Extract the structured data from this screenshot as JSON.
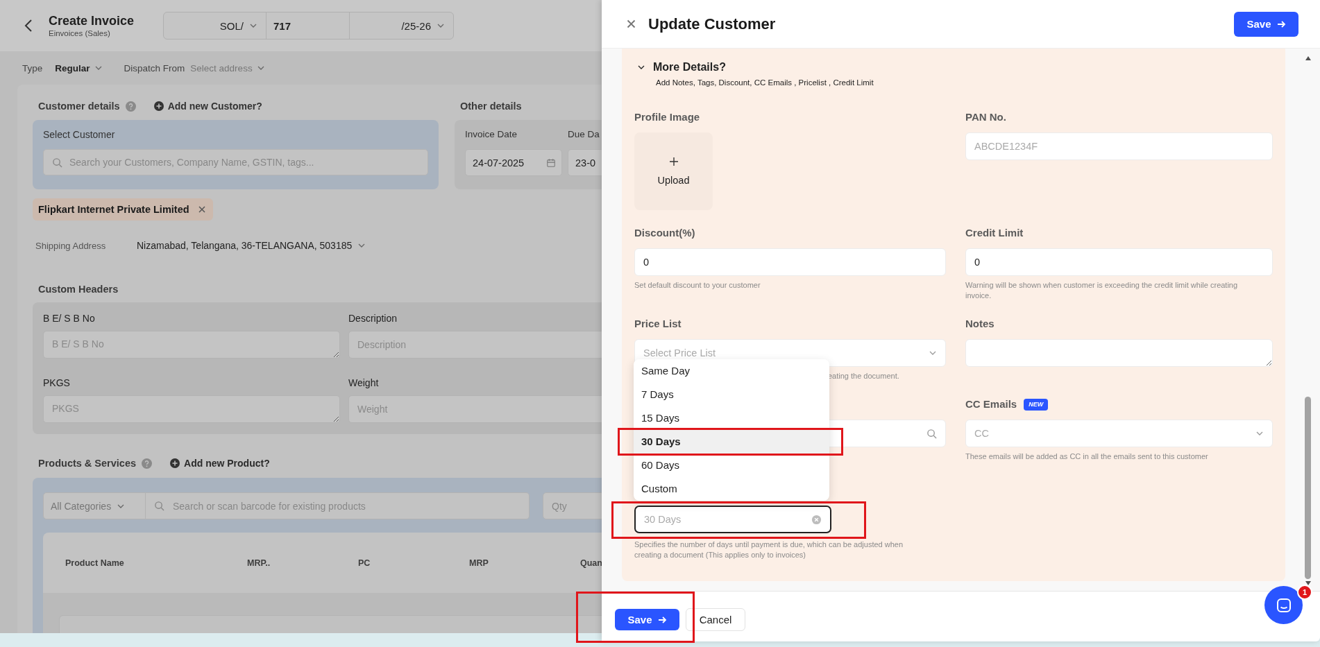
{
  "invoice_page": {
    "title": "Create Invoice",
    "subtitle": "Einvoices (Sales)",
    "number": {
      "prefix": "SOL/",
      "number": "717",
      "suffix": "/25-26"
    },
    "type": {
      "label": "Type",
      "value": "Regular"
    },
    "dispatch": {
      "label": "Dispatch From",
      "placeholder": "Select address"
    },
    "customer": {
      "heading": "Customer details",
      "add_link": "Add new Customer?",
      "select_label": "Select Customer",
      "search_placeholder": "Search your Customers, Company Name, GSTIN, tags...",
      "chip": "Flipkart Internet Private Limited",
      "shipping_label": "Shipping Address",
      "shipping_value": "Nizamabad, Telangana, 36-TELANGANA, 503185"
    },
    "other": {
      "heading": "Other details",
      "fields": [
        {
          "label": "Invoice Date",
          "value": "24-07-2025",
          "kind": "date"
        },
        {
          "label": "Due Da",
          "value": "23-0",
          "kind": "text"
        }
      ]
    },
    "custom_headers": {
      "heading": "Custom Headers",
      "fields": [
        {
          "label": "B E/ S B No",
          "placeholder": "B E/ S B No",
          "kind": "textarea"
        },
        {
          "label": "Description",
          "placeholder": "Description",
          "kind": "input"
        },
        {
          "label": "PKGS",
          "placeholder": "PKGS",
          "kind": "textarea"
        },
        {
          "label": "Weight",
          "placeholder": "Weight",
          "kind": "input"
        }
      ]
    },
    "products": {
      "heading": "Products & Services",
      "add_link": "Add new Product?",
      "category": "All Categories",
      "search_placeholder": "Search or scan barcode for existing products",
      "qty_placeholder": "Qty",
      "columns": [
        "Product Name",
        "MRP..",
        "PC",
        "MRP",
        "Quan"
      ]
    }
  },
  "drawer": {
    "title": "Update Customer",
    "save": "Save",
    "section": {
      "title": "More Details?",
      "expanded": true,
      "subtitle": "Add Notes, Tags, Discount, CC Emails , Pricelist , Credit Limit"
    },
    "fields": [
      {
        "kind": "upload",
        "label": "Profile Image",
        "button": "Upload"
      },
      {
        "kind": "input",
        "label": "PAN No.",
        "placeholder": "ABCDE1234F"
      },
      {
        "kind": "input",
        "label": "Discount(%)",
        "value": "0",
        "hint": "Set default discount to your customer"
      },
      {
        "kind": "input",
        "label": "Credit Limit",
        "value": "0",
        "hint": "Warning will be shown when customer is exceeding the credit limit while creating invoice."
      },
      {
        "kind": "select",
        "label": "Price List",
        "placeholder": "Select Price List",
        "hint": "eating the document.",
        "hint_covered": true
      },
      {
        "kind": "textarea",
        "label": "Notes"
      },
      {
        "kind": "search"
      },
      {
        "kind": "select",
        "label": "CC Emails",
        "badge": "NEW",
        "placeholder": "CC",
        "hint": "These emails will be added as CC in all the emails sent to this customer"
      },
      {
        "kind": "combo",
        "placeholder": "30 Days",
        "focused": true,
        "hint": "Specifies the number of days until payment is due, which can be adjusted when creating a document (This applies only to invoices)",
        "options": [
          {
            "label": "Same Day",
            "selected": false
          },
          {
            "label": "7 Days",
            "selected": false
          },
          {
            "label": "15 Days",
            "selected": false
          },
          {
            "label": "30 Days",
            "selected": true
          },
          {
            "label": "60 Days",
            "selected": false
          },
          {
            "label": "Custom",
            "selected": false
          }
        ]
      }
    ],
    "footer": {
      "save": "Save",
      "cancel": "Cancel"
    },
    "chat": {
      "badge": "1"
    }
  },
  "annotations": [
    {
      "kind": "highlight"
    },
    {
      "kind": "highlight"
    },
    {
      "kind": "highlight"
    }
  ]
}
